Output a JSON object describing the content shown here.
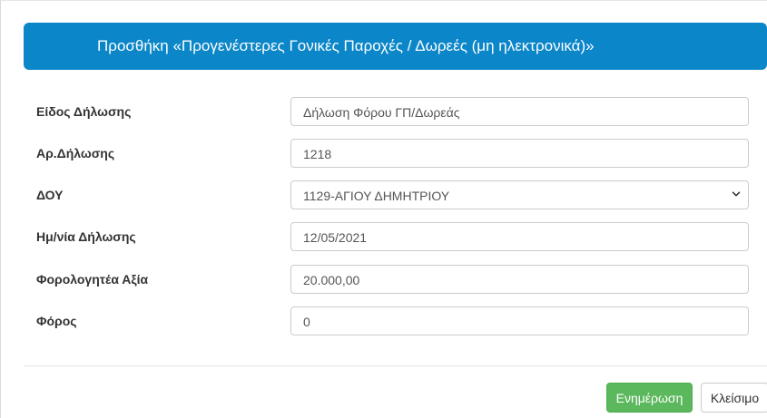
{
  "dialog": {
    "title": "Προσθήκη «Προγενέστερες Γονικές Παροχές / Δωρεές (μη ηλεκτρονικά)»"
  },
  "form": {
    "fields": [
      {
        "label": "Είδος Δήλωσης",
        "value": " Δήλωση Φόρου ΓΠ/Δωρεάς",
        "type": "text"
      },
      {
        "label": "Αρ.Δήλωσης",
        "value": "1218",
        "type": "text"
      },
      {
        "label": "ΔΟΥ",
        "value": "1129-ΑΓΙΟΥ ΔΗΜΗΤΡΙΟΥ",
        "type": "select",
        "icon": "chevron-down-icon"
      },
      {
        "label": "Ημ/νία Δήλωσης",
        "value": "12/05/2021",
        "type": "text"
      },
      {
        "label": "Φορολογητέα Αξία",
        "value": "20.000,00",
        "type": "text"
      },
      {
        "label": "Φόρος",
        "value": "0",
        "type": "text"
      }
    ]
  },
  "footer": {
    "update_label": "Ενημέρωση",
    "close_label": "Κλείσιμο"
  },
  "colors": {
    "header_bg": "#0a86c9",
    "primary_button": "#5cb85c"
  }
}
